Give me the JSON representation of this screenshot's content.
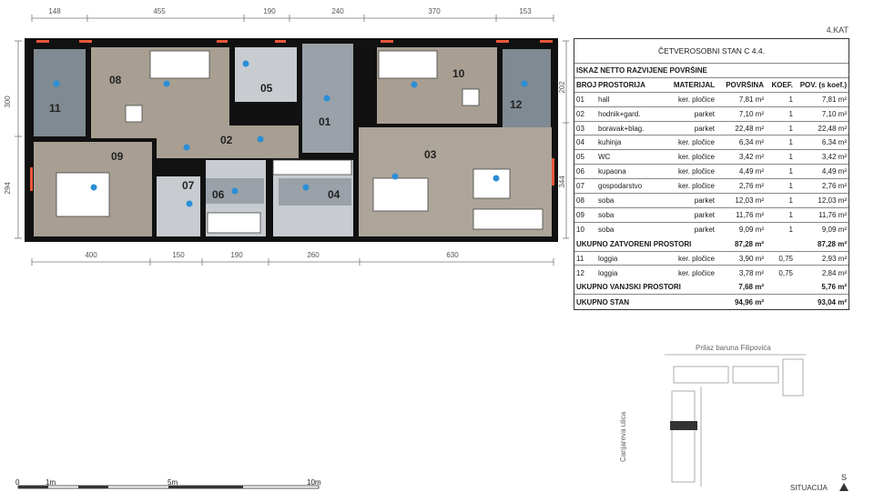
{
  "floor_label": "4.KAT",
  "table": {
    "title": "ČETVEROSOBNI STAN C 4.4.",
    "subtitle": "ISKAZ NETTO RAZVIJENE POVRŠINE",
    "headers": [
      "BROJ",
      "PROSTORIJA",
      "MATERIJAL",
      "POVRŠINA",
      "KOEF.",
      "POV. (s koef.)"
    ],
    "rows": [
      {
        "n": "01",
        "name": "hall",
        "mat": "ker. pločice",
        "area": "7,81 m²",
        "k": "1",
        "areak": "7,81 m²"
      },
      {
        "n": "02",
        "name": "hodnik+gard.",
        "mat": "parket",
        "area": "7,10 m²",
        "k": "1",
        "areak": "7,10 m²"
      },
      {
        "n": "03",
        "name": "boravak+blag.",
        "mat": "parket",
        "area": "22,48 m²",
        "k": "1",
        "areak": "22,48 m²"
      },
      {
        "n": "04",
        "name": "kuhinja",
        "mat": "ker. pločice",
        "area": "6,34 m²",
        "k": "1",
        "areak": "6,34 m²"
      },
      {
        "n": "05",
        "name": "WC",
        "mat": "ker. pločice",
        "area": "3,42 m²",
        "k": "1",
        "areak": "3,42 m²"
      },
      {
        "n": "06",
        "name": "kupaona",
        "mat": "ker. pločice",
        "area": "4,49 m²",
        "k": "1",
        "areak": "4,49 m²"
      },
      {
        "n": "07",
        "name": "gospodarstvo",
        "mat": "ker. pločice",
        "area": "2,76 m²",
        "k": "1",
        "areak": "2,76 m²"
      },
      {
        "n": "08",
        "name": "soba",
        "mat": "parket",
        "area": "12,03 m²",
        "k": "1",
        "areak": "12,03 m²"
      },
      {
        "n": "09",
        "name": "soba",
        "mat": "parket",
        "area": "11,76 m²",
        "k": "1",
        "areak": "11,76 m²"
      },
      {
        "n": "10",
        "name": "soba",
        "mat": "parket",
        "area": "9,09 m²",
        "k": "1",
        "areak": "9,09 m²"
      }
    ],
    "closed_total": {
      "label": "UKUPNO ZATVORENI PROSTORI",
      "area": "87,28 m²",
      "areak": "87,28 m²"
    },
    "outdoor_rows": [
      {
        "n": "11",
        "name": "loggia",
        "mat": "ker. pločice",
        "area": "3,90 m²",
        "k": "0,75",
        "areak": "2,93 m²"
      },
      {
        "n": "12",
        "name": "loggia",
        "mat": "ker. pločice",
        "area": "3,78 m²",
        "k": "0,75",
        "areak": "2,84 m²"
      }
    ],
    "outdoor_total": {
      "label": "UKUPNO VANJSKI PROSTORI",
      "area": "7,68 m²",
      "areak": "5,76 m²"
    },
    "grand_total": {
      "label": "UKUPNO STAN",
      "area": "94,96 m²",
      "areak": "93,04 m²"
    }
  },
  "plan": {
    "top_dims": [
      "148",
      "455",
      "190",
      "240",
      "370",
      "153"
    ],
    "bottom_dims": [
      "400",
      "150",
      "190",
      "260",
      "630"
    ],
    "left_dims": [
      "300",
      "294"
    ],
    "right_dims": [
      "202",
      "344"
    ],
    "rooms": [
      "08",
      "05",
      "01",
      "10",
      "11",
      "12",
      "02",
      "03",
      "09",
      "07",
      "06",
      "04"
    ]
  },
  "scale": {
    "labels": [
      "0",
      "1m",
      "5m",
      "10m"
    ]
  },
  "situation": {
    "street_top": "Prilaz baruna Filipovića",
    "street_side": "Canjareva ulica",
    "label": "SITUACIJA",
    "north": "S"
  },
  "colors": {
    "parquet": "#a89f92",
    "tile": "#9aa1a8",
    "loggia": "#7f8a92",
    "wall": "#111111",
    "marker": "#2a8fd6",
    "window": "#e8573a"
  }
}
